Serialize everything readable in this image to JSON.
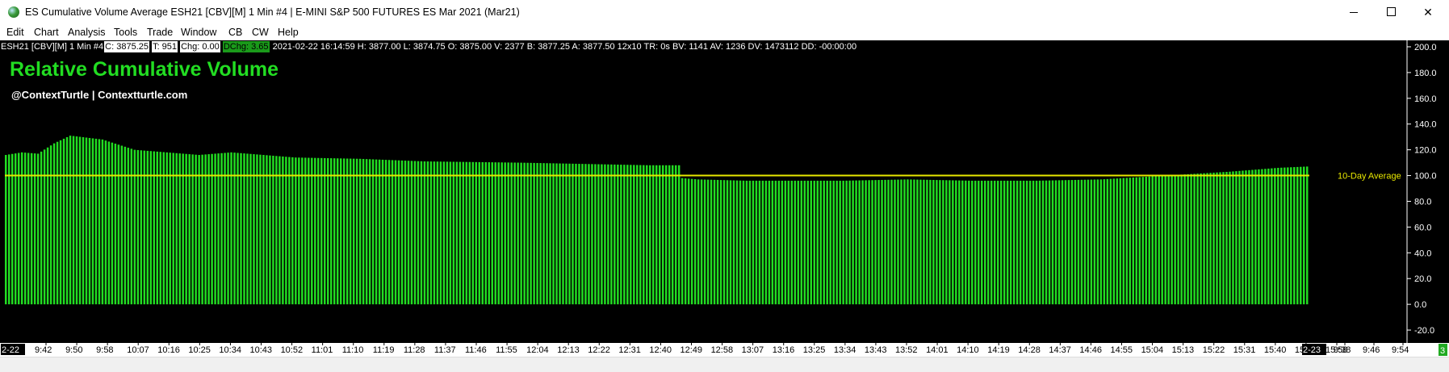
{
  "window": {
    "title": "ES Cumulative Volume Average ESH21 [CBV][M]  1 Min   #4 | E-MINI S&P 500 FUTURES ES Mar 2021 (Mar21)",
    "minimize_glyph": "",
    "maximize_glyph": "",
    "close_glyph": "✕"
  },
  "menu": [
    "Edit",
    "Chart",
    "Analysis",
    "Tools",
    "Trade",
    "Window",
    "CB",
    "CW",
    "Help"
  ],
  "quote": {
    "symbol": "ESH21 [CBV][M]  1 Min   #4",
    "close": "C: 3875.25",
    "ticks": "T: 951",
    "change": "Chg: 0.00",
    "dchange": "DChg: 3.65",
    "rest": "2021-02-22 16:14:59 H: 3877.00 L: 3874.75 O: 3875.00 V: 2377 B: 3877.25 A: 3877.50 12x10 TR: 0s BV: 1141 AV: 1236 DV: 1473112 DD: -00:00:00"
  },
  "overlay": {
    "title": "Relative Cumulative Volume",
    "subtitle": "@ContextTurtle | Contextturtle.com"
  },
  "colors": {
    "background": "#000000",
    "bars": "#22dd22",
    "average_line": "#e8e800",
    "title": "#22dd22",
    "axis_text": "#ffffff"
  },
  "chart_data": {
    "type": "bar",
    "title": "Relative Cumulative Volume",
    "reference_line": {
      "label": "10-Day Average",
      "value": 100
    },
    "ylim": [
      -30,
      205
    ],
    "y_ticks": [
      -20,
      0,
      20,
      40,
      60,
      80,
      100,
      120,
      140,
      160,
      180,
      200
    ],
    "y_tick_labels": [
      "-20.0",
      "0.0",
      "20.0",
      "40.0",
      "60.0",
      "80.0",
      "100.0",
      "120.0",
      "140.0",
      "160.0",
      "180.0",
      "200.0"
    ],
    "x_tick_labels": [
      "2-22",
      "9:42",
      "9:50",
      "9:58",
      "10:07",
      "10:16",
      "10:25",
      "10:34",
      "10:43",
      "10:52",
      "11:01",
      "11:10",
      "11:19",
      "11:28",
      "11:37",
      "11:46",
      "11:55",
      "12:04",
      "12:13",
      "12:22",
      "12:31",
      "12:40",
      "12:49",
      "12:58",
      "13:07",
      "13:16",
      "13:25",
      "13:34",
      "13:43",
      "13:52",
      "14:01",
      "14:10",
      "14:19",
      "14:28",
      "14:37",
      "14:46",
      "14:55",
      "15:04",
      "15:13",
      "15:22",
      "15:31",
      "15:40",
      "15:49",
      "15:58",
      "2-23",
      "9:38",
      "9:46",
      "9:54"
    ],
    "x_tick_label_highlighted": [
      "2-22",
      "2-23"
    ],
    "scroll_marker": "3",
    "bar_count": 405,
    "profile_x": [
      0,
      5,
      10,
      15,
      20,
      30,
      40,
      60,
      70,
      90,
      110,
      130,
      160,
      200,
      209,
      210,
      215,
      230,
      260,
      280,
      300,
      320,
      340,
      360,
      380,
      395,
      404
    ],
    "profile_y": [
      116,
      118,
      117,
      125,
      131,
      128,
      120,
      116,
      118,
      114,
      113,
      111,
      110,
      108,
      108,
      98,
      97,
      96,
      96,
      97,
      96,
      96,
      97,
      100,
      103,
      106,
      107
    ]
  }
}
